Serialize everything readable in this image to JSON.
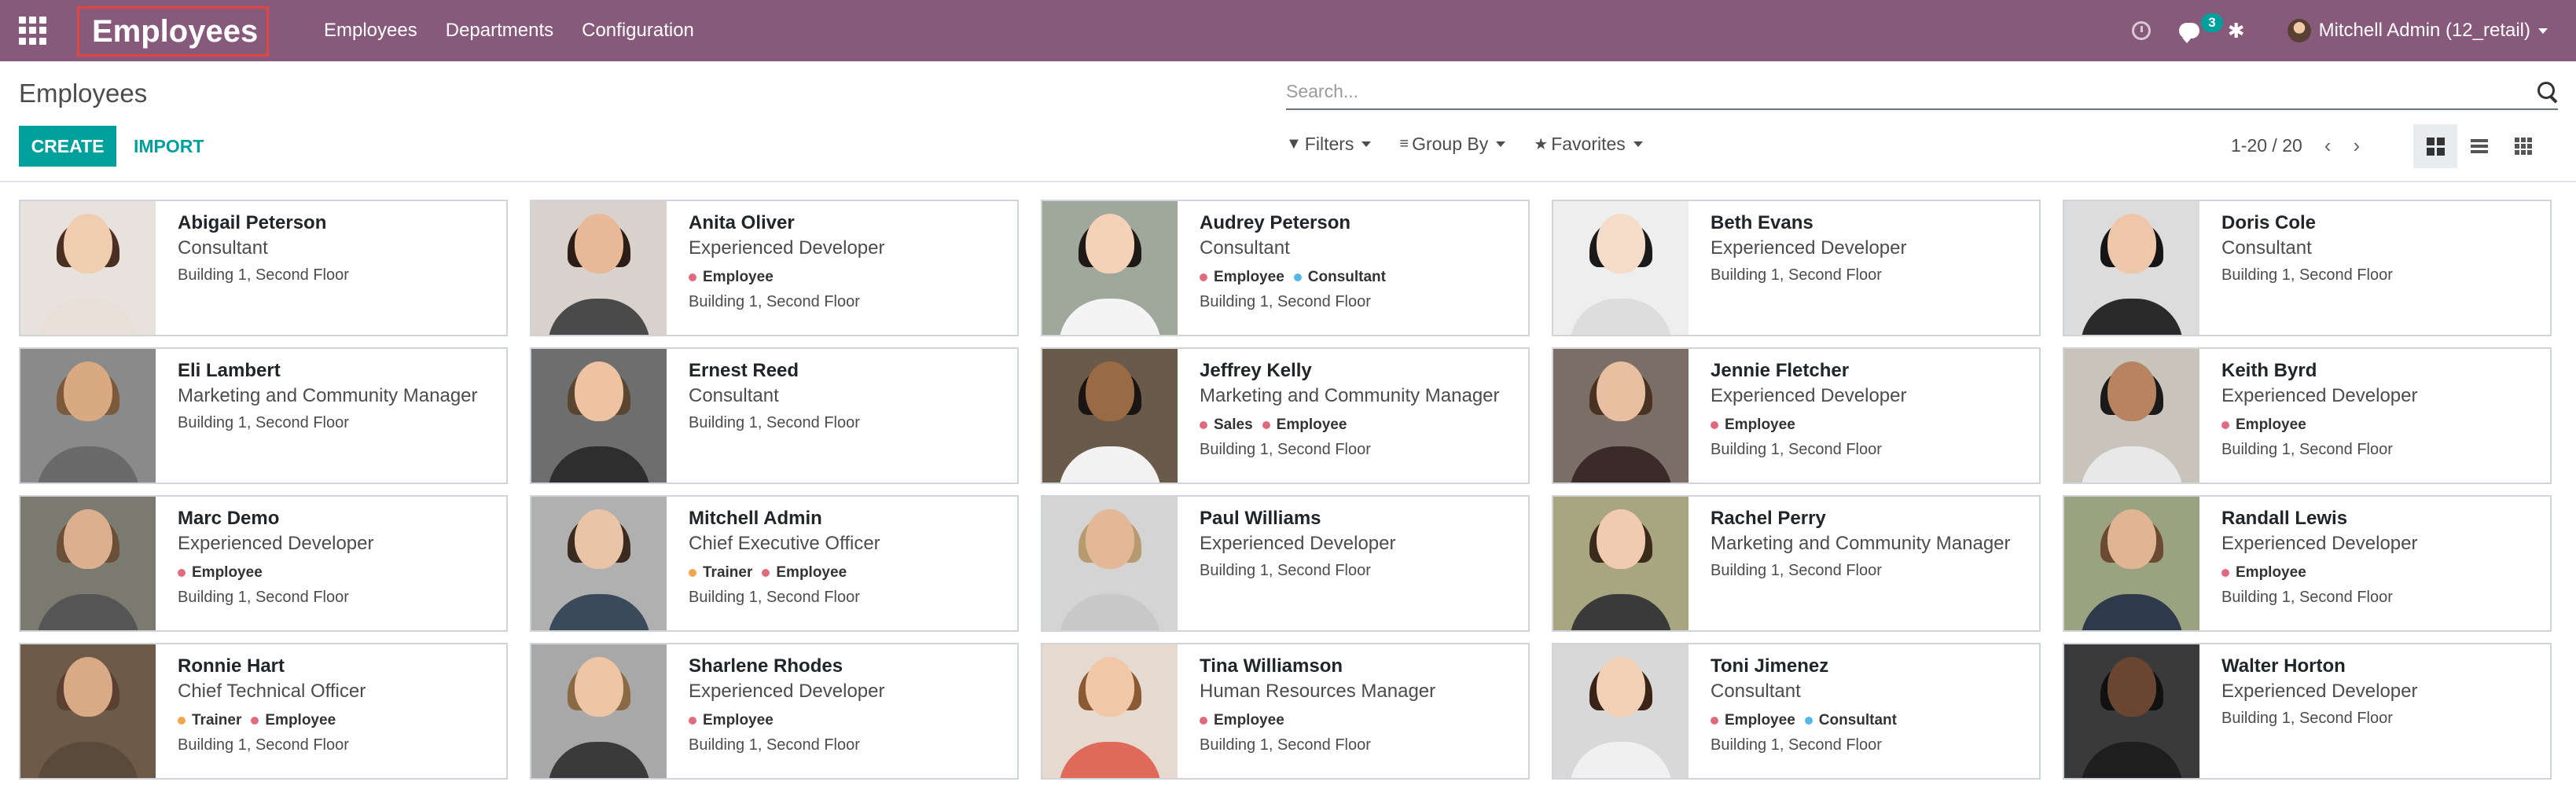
{
  "navbar": {
    "brand": "Employees",
    "menu": [
      "Employees",
      "Departments",
      "Configuration"
    ],
    "chat_badge": "3",
    "user": "Mitchell Admin (12_retail)",
    "color": "#875A7B"
  },
  "control_panel": {
    "breadcrumb": "Employees",
    "create_label": "CREATE",
    "import_label": "IMPORT",
    "search_placeholder": "Search...",
    "filters_label": "Filters",
    "groupby_label": "Group By",
    "favorites_label": "Favorites",
    "pager": "1-20 / 20",
    "accent": "#00A09D"
  },
  "tag_colors": {
    "Employee": "#e06a7e",
    "Consultant": "#56b6e8",
    "Sales": "#e06a7e",
    "Trainer": "#f2a64b"
  },
  "employees": [
    {
      "name": "Abigail Peterson",
      "job": "Consultant",
      "tags": [],
      "location": "Building 1, Second Floor"
    },
    {
      "name": "Anita Oliver",
      "job": "Experienced Developer",
      "tags": [
        "Employee"
      ],
      "location": "Building 1, Second Floor"
    },
    {
      "name": "Audrey Peterson",
      "job": "Consultant",
      "tags": [
        "Employee",
        "Consultant"
      ],
      "location": "Building 1, Second Floor"
    },
    {
      "name": "Beth Evans",
      "job": "Experienced Developer",
      "tags": [],
      "location": "Building 1, Second Floor"
    },
    {
      "name": "Doris Cole",
      "job": "Consultant",
      "tags": [],
      "location": "Building 1, Second Floor"
    },
    {
      "name": "Eli Lambert",
      "job": "Marketing and Community Manager",
      "tags": [],
      "location": "Building 1, Second Floor"
    },
    {
      "name": "Ernest Reed",
      "job": "Consultant",
      "tags": [],
      "location": "Building 1, Second Floor"
    },
    {
      "name": "Jeffrey Kelly",
      "job": "Marketing and Community Manager",
      "tags": [
        "Sales",
        "Employee"
      ],
      "location": "Building 1, Second Floor"
    },
    {
      "name": "Jennie Fletcher",
      "job": "Experienced Developer",
      "tags": [
        "Employee"
      ],
      "location": "Building 1, Second Floor"
    },
    {
      "name": "Keith Byrd",
      "job": "Experienced Developer",
      "tags": [
        "Employee"
      ],
      "location": "Building 1, Second Floor"
    },
    {
      "name": "Marc Demo",
      "job": "Experienced Developer",
      "tags": [
        "Employee"
      ],
      "location": "Building 1, Second Floor"
    },
    {
      "name": "Mitchell Admin",
      "job": "Chief Executive Officer",
      "tags": [
        "Trainer",
        "Employee"
      ],
      "location": "Building 1, Second Floor"
    },
    {
      "name": "Paul Williams",
      "job": "Experienced Developer",
      "tags": [],
      "location": "Building 1, Second Floor"
    },
    {
      "name": "Rachel Perry",
      "job": "Marketing and Community Manager",
      "tags": [],
      "location": "Building 1, Second Floor"
    },
    {
      "name": "Randall Lewis",
      "job": "Experienced Developer",
      "tags": [
        "Employee"
      ],
      "location": "Building 1, Second Floor"
    },
    {
      "name": "Ronnie Hart",
      "job": "Chief Technical Officer",
      "tags": [
        "Trainer",
        "Employee"
      ],
      "location": "Building 1, Second Floor"
    },
    {
      "name": "Sharlene Rhodes",
      "job": "Experienced Developer",
      "tags": [
        "Employee"
      ],
      "location": "Building 1, Second Floor"
    },
    {
      "name": "Tina Williamson",
      "job": "Human Resources Manager",
      "tags": [
        "Employee"
      ],
      "location": "Building 1, Second Floor"
    },
    {
      "name": "Toni Jimenez",
      "job": "Consultant",
      "tags": [
        "Employee",
        "Consultant"
      ],
      "location": "Building 1, Second Floor"
    },
    {
      "name": "Walter Horton",
      "job": "Experienced Developer",
      "tags": [],
      "location": "Building 1, Second Floor"
    }
  ]
}
